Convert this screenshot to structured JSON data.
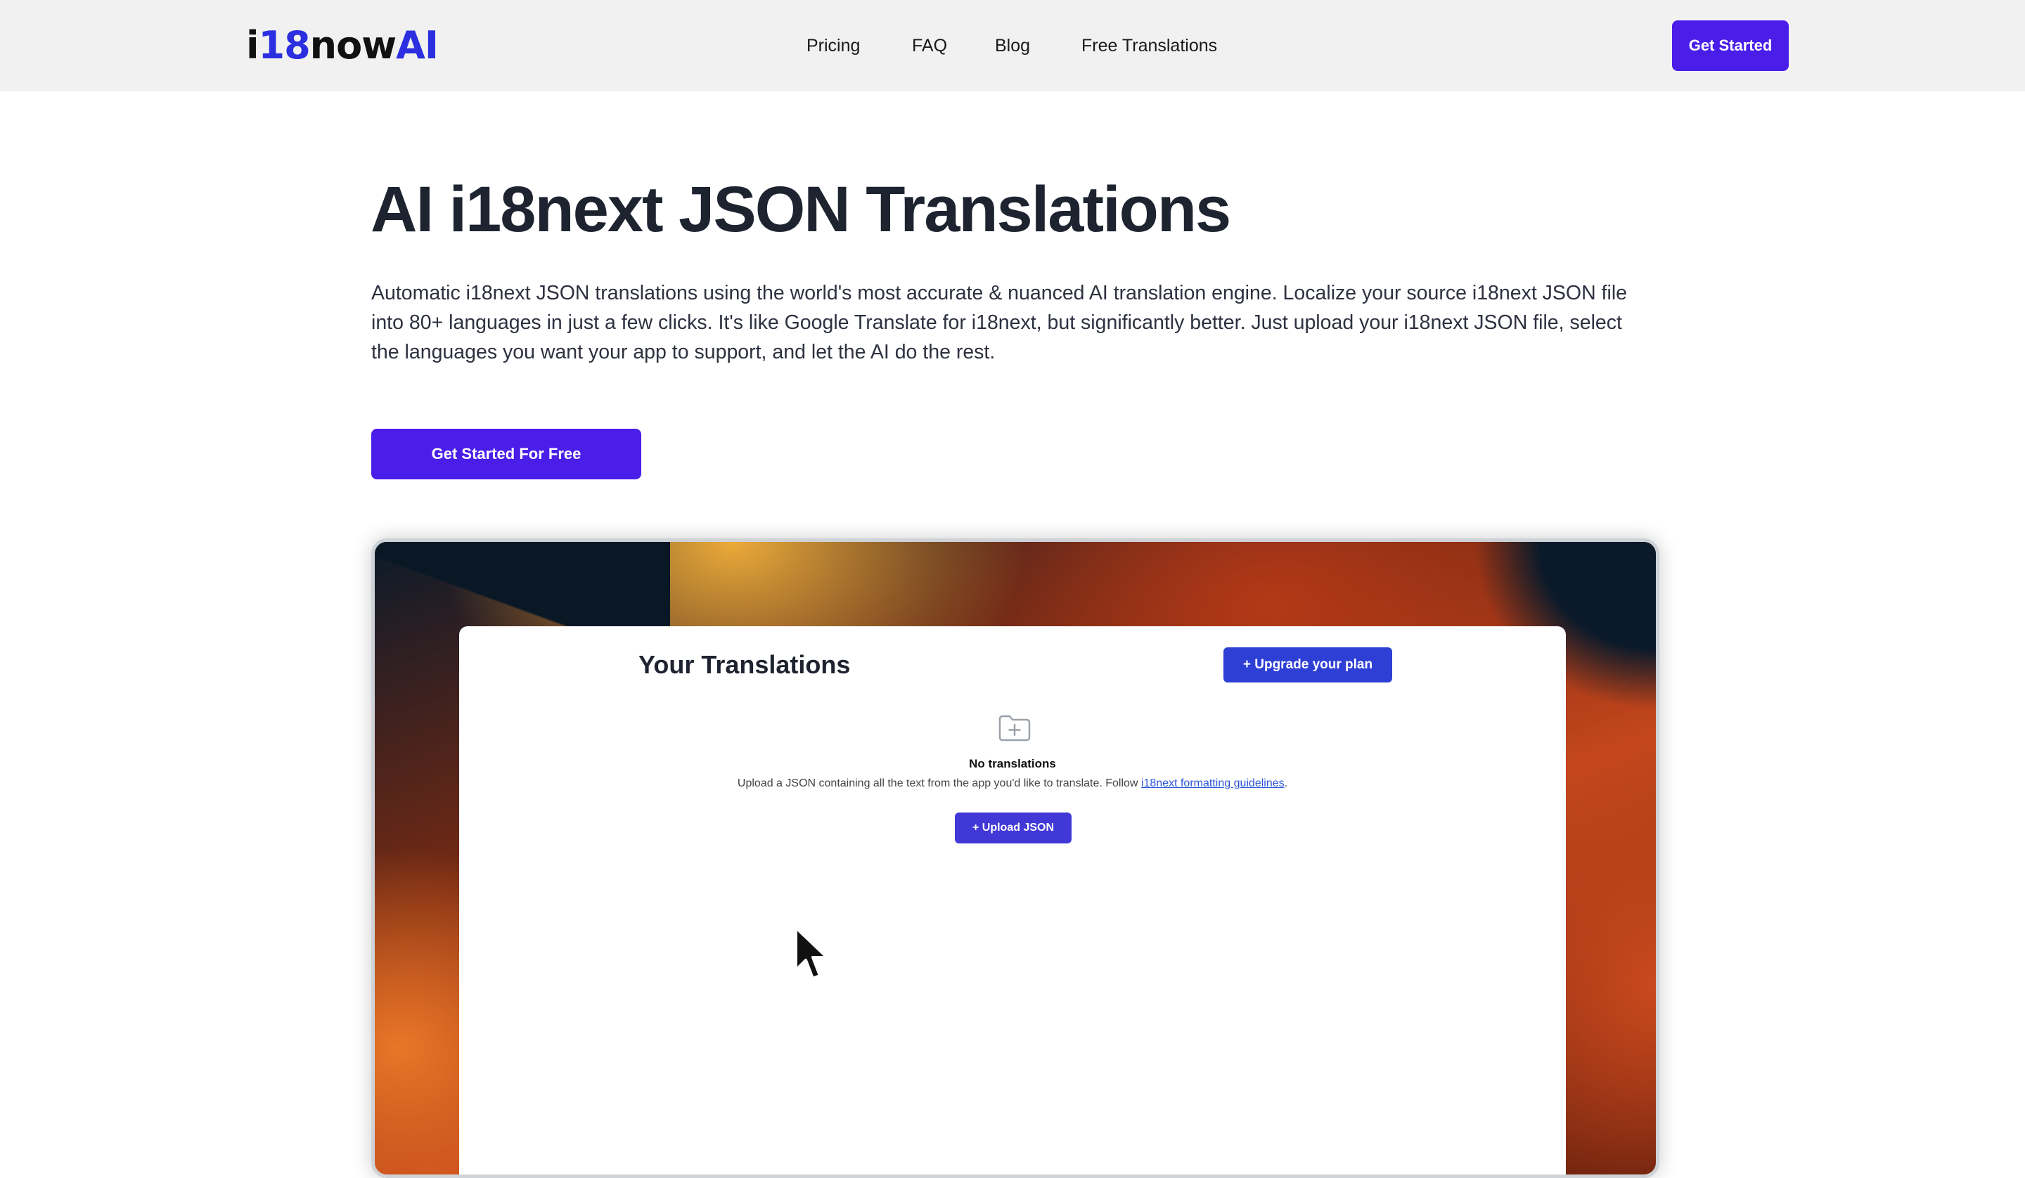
{
  "header": {
    "logo": {
      "part1": "i",
      "part2": "18",
      "part3": "now",
      "part4": "AI"
    },
    "nav": [
      {
        "label": "Pricing"
      },
      {
        "label": "FAQ"
      },
      {
        "label": "Blog"
      },
      {
        "label": "Free Translations"
      }
    ],
    "cta_label": "Get Started"
  },
  "hero": {
    "title": "AI i18next JSON Translations",
    "description": "Automatic i18next JSON translations using the world's most accurate & nuanced AI translation engine. Localize your source i18next JSON file into 80+ languages in just a few clicks. It's like Google Translate for i18next, but significantly better. Just upload your i18next JSON file, select the languages you want your app to support, and let the AI do the rest.",
    "cta_label": "Get Started For Free"
  },
  "preview": {
    "title": "Your Translations",
    "upgrade_label": "+ Upgrade your plan",
    "empty_title": "No translations",
    "empty_desc_prefix": "Upload a JSON containing all the text from the app you'd like to translate. Follow ",
    "empty_desc_link": "i18next formatting guidelines",
    "empty_desc_suffix": ".",
    "upload_label": "+  Upload JSON"
  },
  "colors": {
    "brand": "#4a1de8",
    "logo_blue": "#2b2fe0",
    "header_bg": "#f1f1f1",
    "preview_button": "#2e3fd6"
  },
  "icons": [
    "folder-plus-icon",
    "mouse-cursor-icon"
  ]
}
